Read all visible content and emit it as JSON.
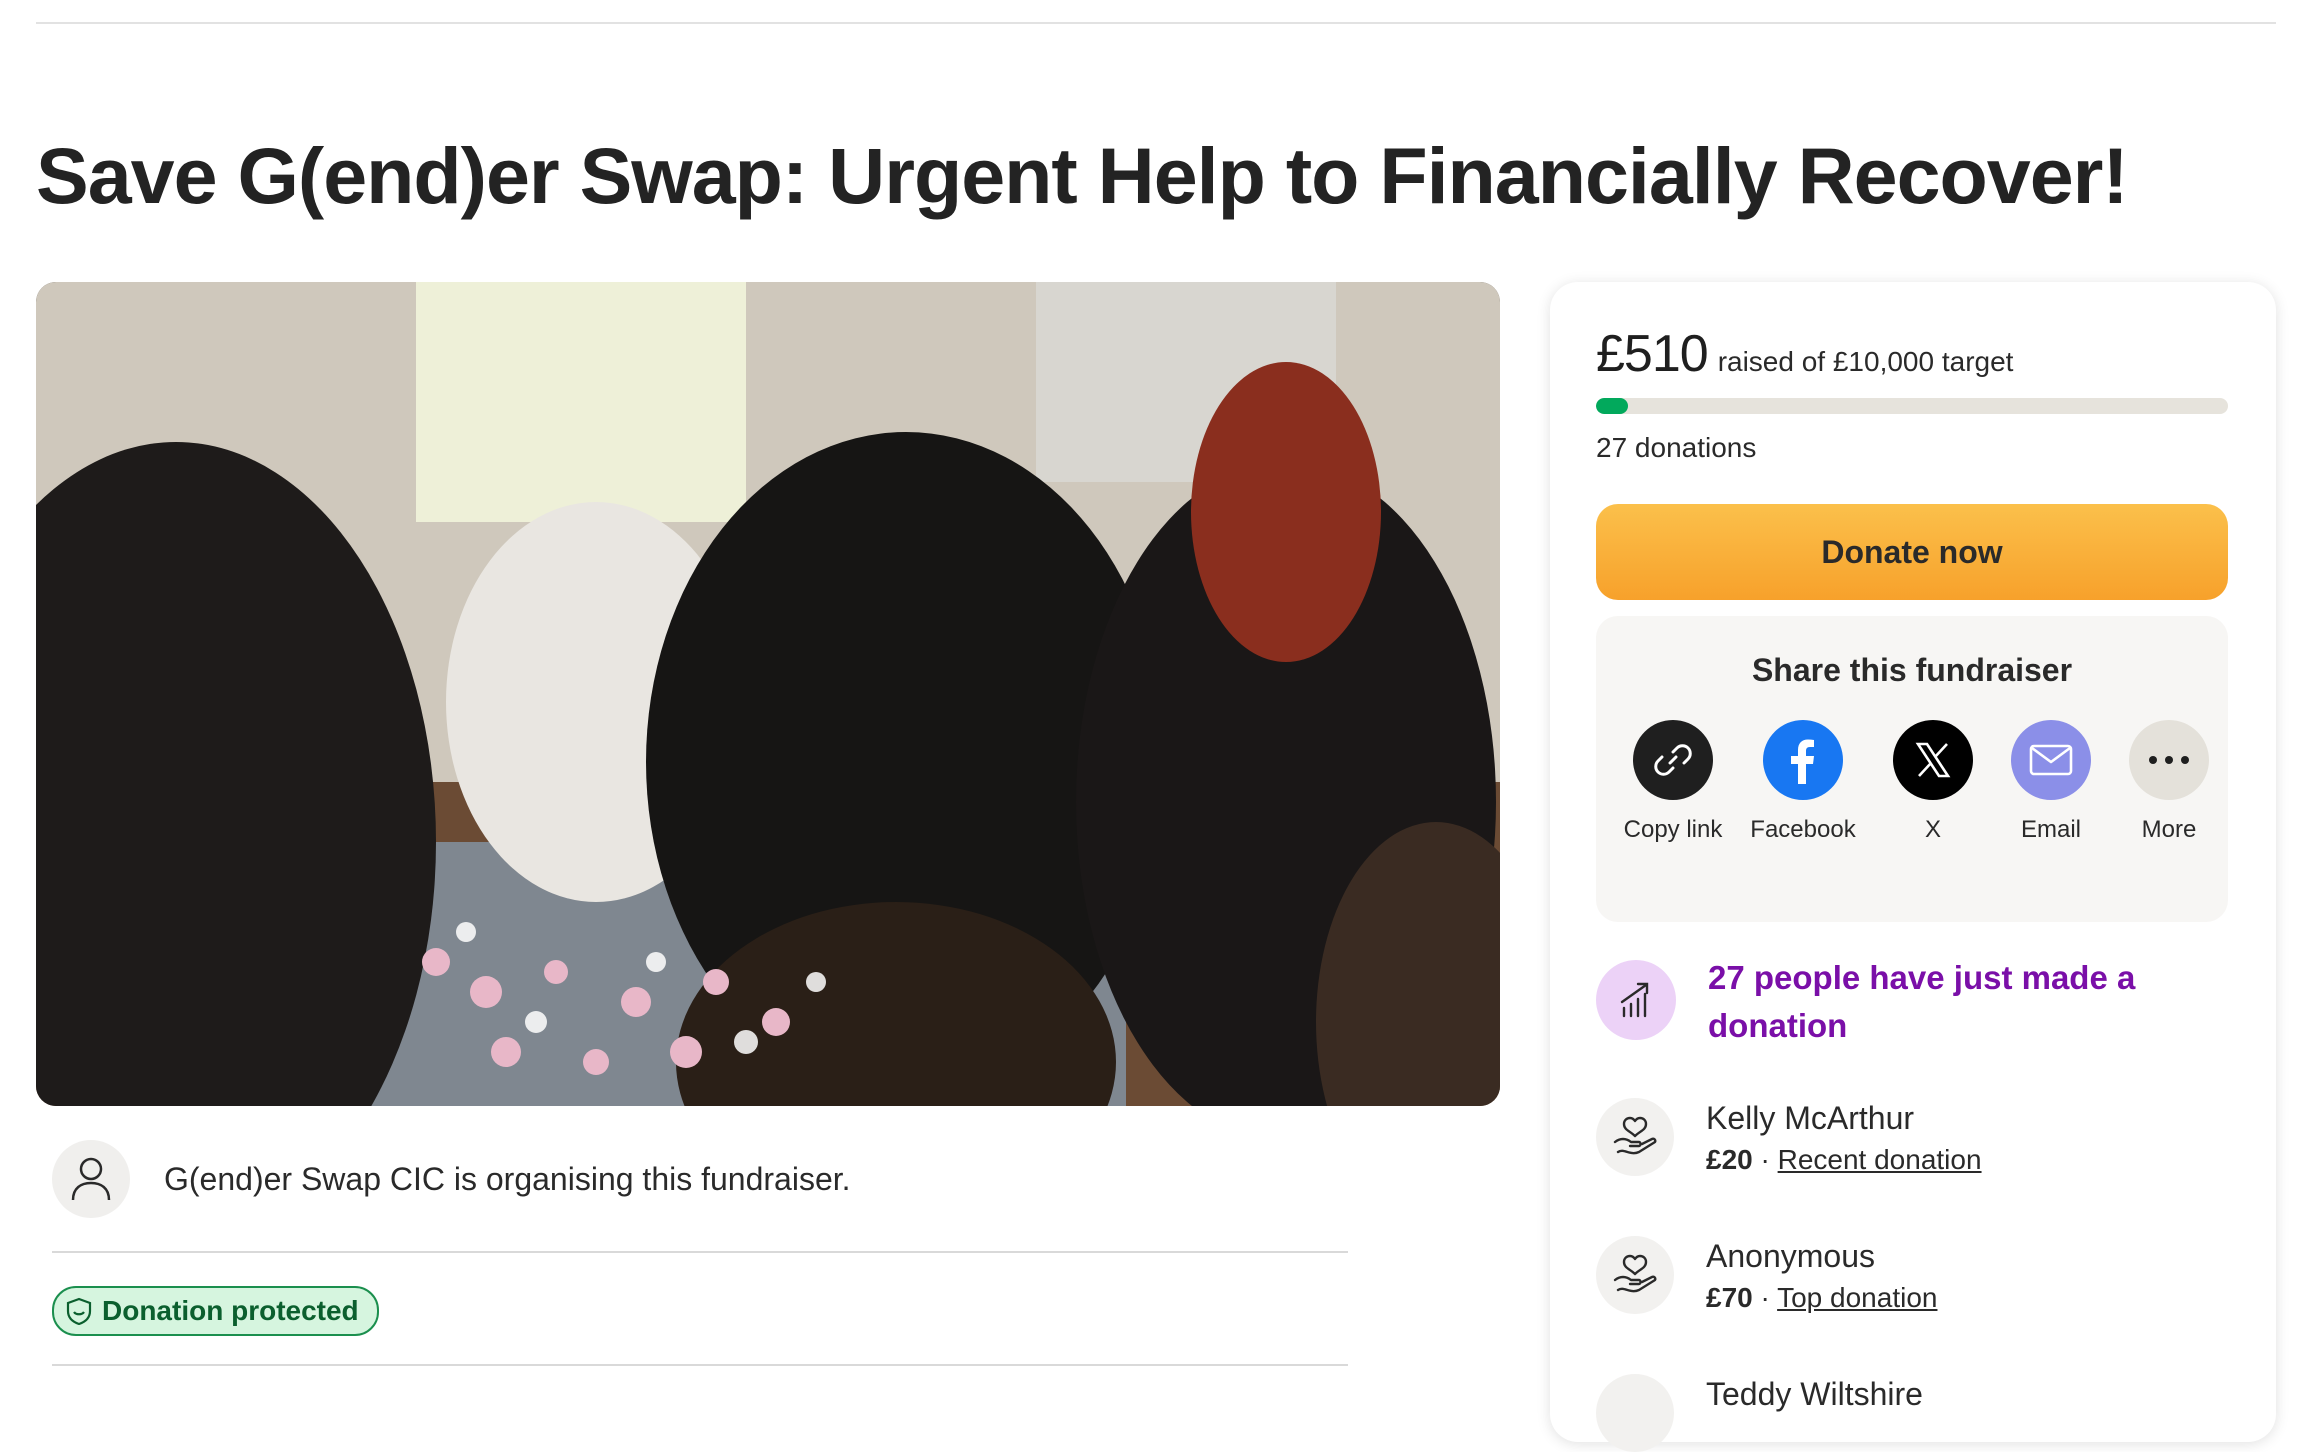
{
  "page": {
    "title": "Save G(end)er Swap: Urgent Help to Financially Recover!"
  },
  "organiser": {
    "text": "G(end)er Swap CIC is organising this fundraiser."
  },
  "protection_badge": "Donation protected",
  "summary": {
    "raised": "£510",
    "target_text": "raised of £10,000 target",
    "progress_fraction": 0.051,
    "donations": "27 donations",
    "donate_label": "Donate now"
  },
  "share": {
    "title": "Share this fundraiser",
    "items": [
      {
        "label": "Copy link",
        "icon": "link-icon",
        "color": "#1f1f1f"
      },
      {
        "label": "Facebook",
        "icon": "facebook-icon",
        "color": "#1877f2"
      },
      {
        "label": "X",
        "icon": "x-icon",
        "color": "#000000"
      },
      {
        "label": "Email",
        "icon": "email-icon",
        "color": "#8b8fe8"
      },
      {
        "label": "More",
        "icon": "more-icon",
        "color": "#e4e1da"
      }
    ]
  },
  "recent_activity": "27 people have just made a donation",
  "donors": [
    {
      "name": "Kelly McArthur",
      "amount": "£20",
      "tag": "Recent donation"
    },
    {
      "name": "Anonymous",
      "amount": "£70",
      "tag": "Top donation"
    },
    {
      "name": "Teddy Wiltshire"
    }
  ],
  "colors": {
    "progress": "#02a95c",
    "donate_button": "#f9ae3a",
    "recent_text": "#7a0fa8",
    "badge_border": "#1b8f4e"
  }
}
